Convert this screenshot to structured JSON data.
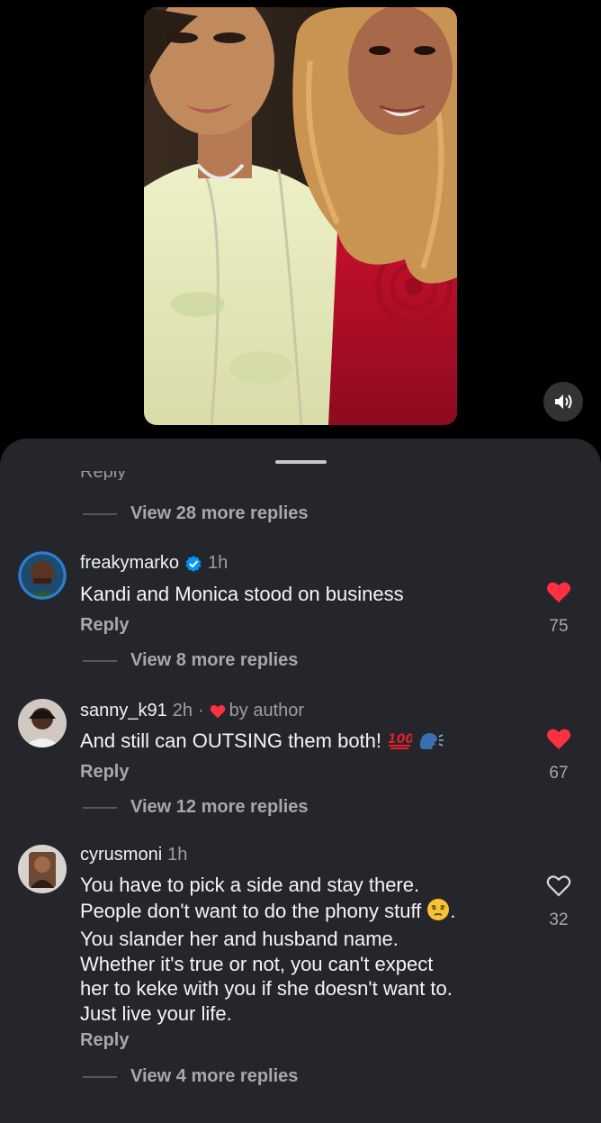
{
  "media": {
    "sound_icon": "speaker-icon"
  },
  "sheet": {
    "cut_text": "Reply",
    "threads": [
      {
        "view_more": "View 28 more replies"
      }
    ],
    "comments": [
      {
        "username": "freakymarko",
        "verified": true,
        "time": "1h",
        "text": "Kandi and Monica stood on business",
        "reply_label": "Reply",
        "likes": "75",
        "liked": true,
        "view_more": "View 8 more replies"
      },
      {
        "username": "sanny_k91",
        "time": "2h",
        "separator": "·",
        "author_like": "by author",
        "text": "And still can OUTSING them both!",
        "emojis": [
          "hundred-points-emoji",
          "speaking-head-emoji"
        ],
        "reply_label": "Reply",
        "likes": "67",
        "liked": true,
        "view_more": "View 12 more replies"
      },
      {
        "username": "cyrusmoni",
        "time": "1h",
        "text_lines": [
          "You have to pick a side and stay there.",
          "People don't want to do the phony stuff",
          "You slander her and husband name.",
          "Whether it's true or not, you can't expect",
          "her to keke with you if she doesn't want to.",
          "Just live your life."
        ],
        "emoji": "unamused-face-emoji",
        "reply_label": "Reply",
        "likes": "32",
        "liked": false,
        "view_more": "View 4 more replies"
      }
    ]
  },
  "colors": {
    "sheet_bg": "#25262b",
    "like_red": "#ff3040",
    "verified_blue": "#0095f6",
    "muted": "#a6a8ae"
  }
}
